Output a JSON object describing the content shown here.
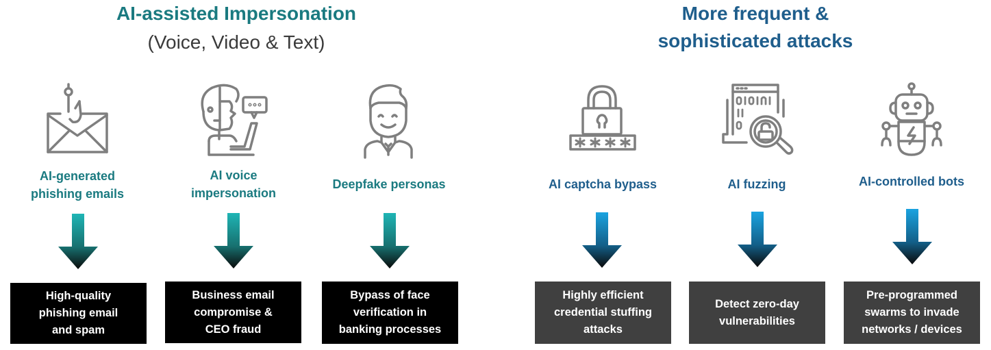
{
  "sections": {
    "left": {
      "title": "AI-assisted Impersonation",
      "subtitle": "(Voice, Video & Text)",
      "accent_color": "#1a7a80",
      "items": [
        {
          "icon": "phishing-email-hook-icon",
          "label_lines": [
            "AI-generated",
            "phishing emails"
          ],
          "outcome_lines": [
            "High-quality",
            "phishing email",
            "and spam"
          ]
        },
        {
          "icon": "voice-impersonation-person-icon",
          "label_lines": [
            "AI voice",
            "impersonation"
          ],
          "outcome_lines": [
            "Business email",
            "compromise &",
            "CEO fraud"
          ]
        },
        {
          "icon": "deepfake-persona-icon",
          "label_lines": [
            "Deepfake personas"
          ],
          "outcome_lines": [
            "Bypass of face",
            "verification in",
            "banking processes"
          ]
        }
      ]
    },
    "right": {
      "title_lines": [
        "More frequent &",
        "sophisticated attacks"
      ],
      "accent_color": "#1f5e8c",
      "items": [
        {
          "icon": "password-lock-icon",
          "label_lines": [
            "AI captcha bypass"
          ],
          "outcome_lines": [
            "Highly efficient",
            "credential stuffing",
            "attacks"
          ]
        },
        {
          "icon": "code-search-lock-icon",
          "label_lines": [
            "AI fuzzing"
          ],
          "outcome_lines": [
            "Detect zero-day",
            "vulnerabilities"
          ]
        },
        {
          "icon": "robot-icon",
          "label_lines": [
            "AI-controlled bots"
          ],
          "outcome_lines": [
            "Pre-programmed",
            "swarms to invade",
            "networks / devices"
          ]
        }
      ]
    }
  },
  "colors": {
    "icon_stroke": "#7f7f7f",
    "left_box": "#000000",
    "right_box": "#404040",
    "teal_arrow_top": "#1fb5b5",
    "blue_arrow_top": "#1aa3e0",
    "arrow_bottom": "#0a0a0a"
  }
}
